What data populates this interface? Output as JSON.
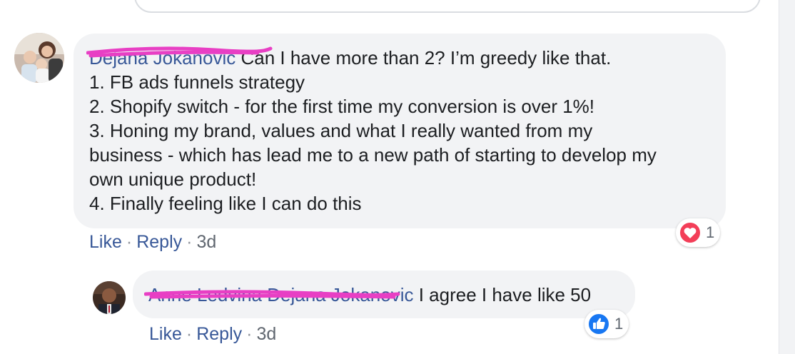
{
  "comment": {
    "author": "Dejana Jokanovic",
    "lines": [
      "Can I have more than 2? I’m greedy like that.",
      "1. FB ads funnels strategy",
      "2. Shopify switch - for the first time my conversion is over 1%!",
      "3. Honing my brand, values and what I really wanted from my",
      "business - which has lead me to a new path of starting to develop my",
      "own unique product!",
      "4. Finally feeling like I can do this"
    ],
    "like_label": "Like",
    "reply_label": "Reply",
    "separator": "·",
    "time": "3d",
    "reaction_count": "1",
    "reaction_icon": "heart-reaction-icon"
  },
  "reply": {
    "author": "Anne Ledvina Dejana Jokanovic",
    "text": "I agree I have like 50",
    "like_label": "Like",
    "reply_label": "Reply",
    "separator": "·",
    "time": "3d",
    "reaction_count": "1",
    "reaction_icon": "thumbs-up-reaction-icon"
  },
  "colors": {
    "link": "#385898",
    "bubble": "#f2f3f5",
    "redaction_scribble": "#e83fc4",
    "heart": "#f33e58",
    "like": "#1877f2"
  }
}
